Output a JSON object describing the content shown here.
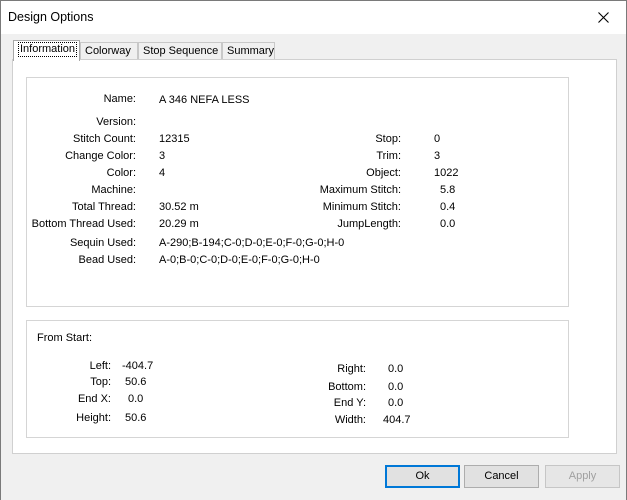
{
  "window": {
    "title": "Design Options"
  },
  "tabs": [
    {
      "label": "Information",
      "active": true
    },
    {
      "label": "Colorway",
      "active": false
    },
    {
      "label": "Stop Sequence",
      "active": false
    },
    {
      "label": "Summary",
      "active": false
    }
  ],
  "info": {
    "name": {
      "label": "Name:",
      "value": "A 346 NEFA LESS"
    },
    "version": {
      "label": "Version:",
      "value": ""
    },
    "stitch_count": {
      "label": "Stitch Count:",
      "value": "12315"
    },
    "change_color": {
      "label": "Change Color:",
      "value": "3"
    },
    "color": {
      "label": "Color:",
      "value": "4"
    },
    "machine": {
      "label": "Machine:",
      "value": ""
    },
    "total_thread": {
      "label": "Total Thread:",
      "value": "30.52 m"
    },
    "bottom_thread": {
      "label": "Bottom Thread Used:",
      "value": "20.29 m"
    },
    "sequin_used": {
      "label": "Sequin Used:",
      "value": "A-290;B-194;C-0;D-0;E-0;F-0;G-0;H-0"
    },
    "bead_used": {
      "label": "Bead Used:",
      "value": "A-0;B-0;C-0;D-0;E-0;F-0;G-0;H-0"
    },
    "stop": {
      "label": "Stop:",
      "value": "0"
    },
    "trim": {
      "label": "Trim:",
      "value": "3"
    },
    "object": {
      "label": "Object:",
      "value": "1022"
    },
    "maximum_stitch": {
      "label": "Maximum Stitch:",
      "value": "5.8"
    },
    "minimum_stitch": {
      "label": "Minimum Stitch:",
      "value": "0.4"
    },
    "jump_length": {
      "label": "JumpLength:",
      "value": "0.0"
    }
  },
  "from_start": {
    "heading": "From Start:",
    "left": {
      "label": "Left:",
      "value": "-404.7"
    },
    "top": {
      "label": "Top:",
      "value": "50.6"
    },
    "end_x": {
      "label": "End X:",
      "value": "0.0"
    },
    "height": {
      "label": "Height:",
      "value": "50.6"
    },
    "right": {
      "label": "Right:",
      "value": "0.0"
    },
    "bottom": {
      "label": "Bottom:",
      "value": "0.0"
    },
    "end_y": {
      "label": "End Y:",
      "value": "0.0"
    },
    "width": {
      "label": "Width:",
      "value": "404.7"
    }
  },
  "buttons": {
    "ok": "Ok",
    "cancel": "Cancel",
    "apply": "Apply"
  },
  "colors": {
    "accent": "#0078d7",
    "disabled_text": "#a0a0a0"
  }
}
